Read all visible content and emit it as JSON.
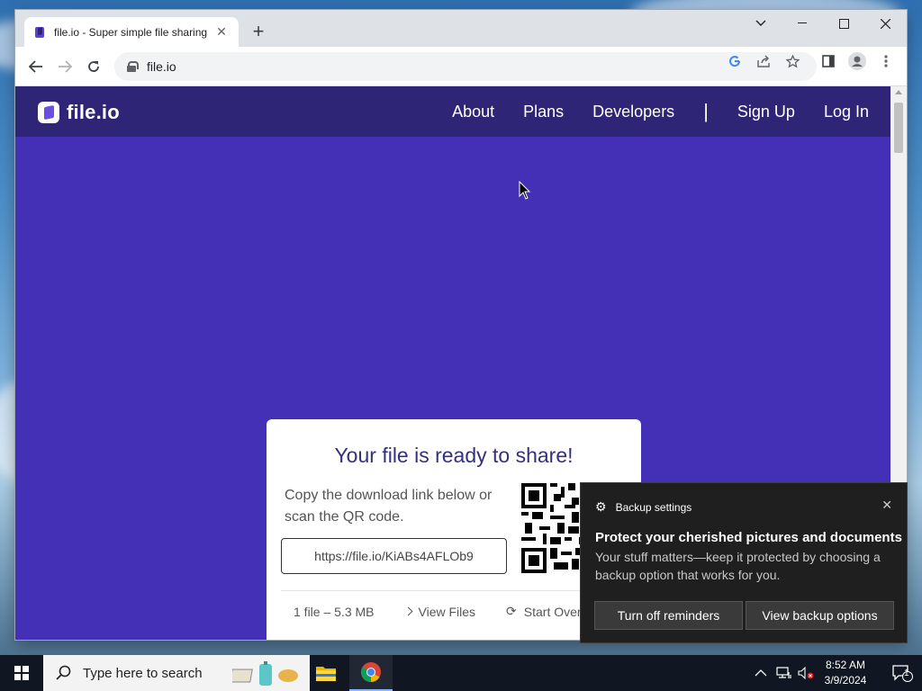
{
  "browser": {
    "tab_title": "file.io - Super simple file sharing",
    "tab_close": "✕",
    "new_tab": "+",
    "url": "file.io"
  },
  "site": {
    "logo_text": "file.io",
    "nav": [
      "About",
      "Plans",
      "Developers",
      "Sign Up",
      "Log In"
    ],
    "separator": "|"
  },
  "card": {
    "title": "Your file is ready to share!",
    "desc": "Copy the download link below or scan the QR code.",
    "link": "https://file.io/KiABs4AFLOb9",
    "file_info": "1 file – 5.3 MB",
    "view_files": "View Files",
    "start_over": "Start Over"
  },
  "toast": {
    "app": "Backup settings",
    "title": "Protect your cherished pictures and documents",
    "body": "Your stuff matters—keep it protected by choosing a backup option that works for you.",
    "btn_off": "Turn off reminders",
    "btn_view": "View backup options"
  },
  "taskbar": {
    "search_placeholder": "Type here to search",
    "time": "8:52 AM",
    "date": "3/9/2024",
    "notif_count": "1"
  }
}
